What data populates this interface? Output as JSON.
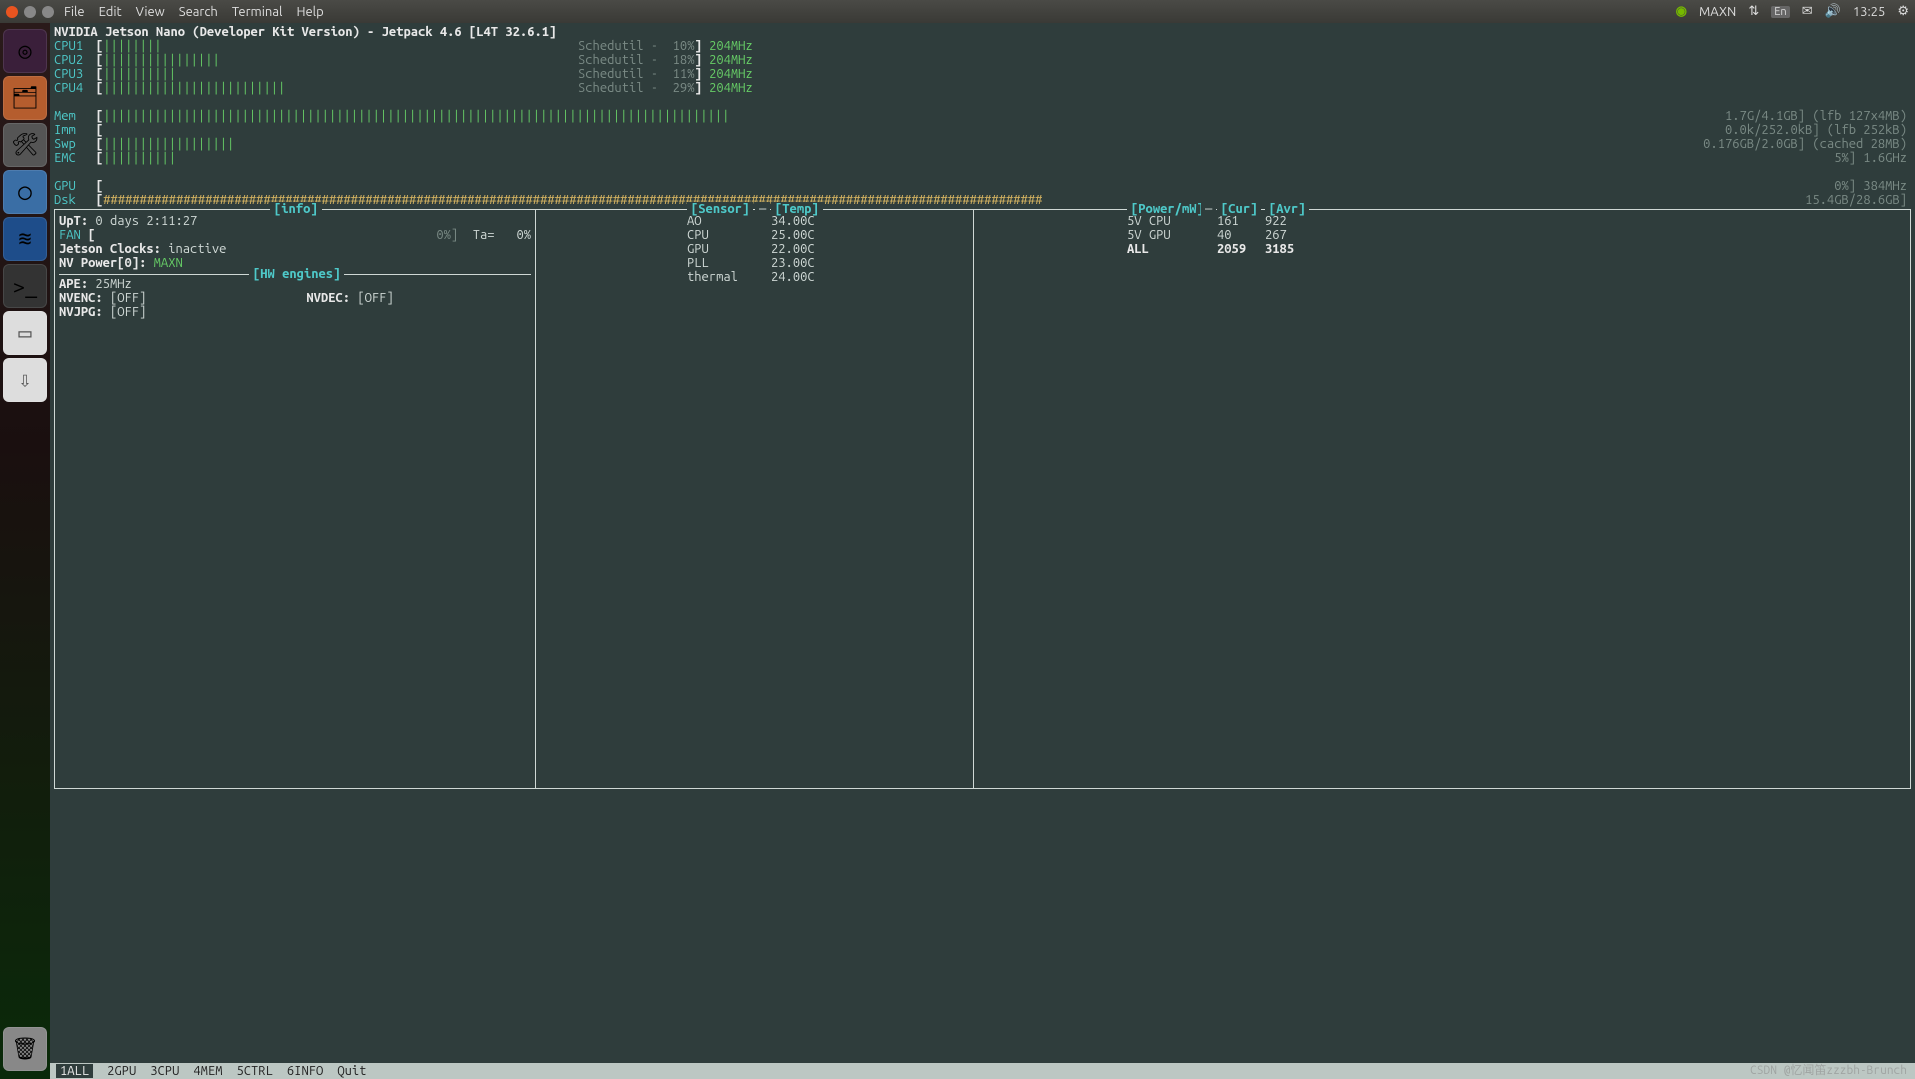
{
  "menubar": {
    "items": [
      "File",
      "Edit",
      "View",
      "Search",
      "Terminal",
      "Help"
    ],
    "status_label": "MAXN",
    "lang_label": "En",
    "time": "13:25"
  },
  "title": "NVIDIA Jetson Nano (Developer Kit Version) - Jetpack 4.6 [L4T 32.6.1]",
  "cpus": [
    {
      "label": "CPU1",
      "bar": "||||||||",
      "gov": "Schedutil",
      "pct": "10%",
      "freq": "204MHz"
    },
    {
      "label": "CPU2",
      "bar": "||||||||||||||||",
      "gov": "Schedutil",
      "pct": "18%",
      "freq": "204MHz"
    },
    {
      "label": "CPU3",
      "bar": "||||||||||",
      "gov": "Schedutil",
      "pct": "11%",
      "freq": "204MHz"
    },
    {
      "label": "CPU4",
      "bar": "|||||||||||||||||||||||||",
      "gov": "Schedutil",
      "pct": "29%",
      "freq": "204MHz"
    }
  ],
  "mem": {
    "label": "Mem",
    "bar": "||||||||||||||||||||||||||||||||||||||||||||||||||||||||||||||||||||||||||||||||||||||",
    "right": "1.7G/4.1GB] (lfb 127x4MB)"
  },
  "imm": {
    "label": "Imm",
    "bar": "",
    "right": "0.0k/252.0kB] (lfb 252kB)"
  },
  "swp": {
    "label": "Swp",
    "bar": "||||||||||||||||||",
    "right": "0.176GB/2.0GB] (cached 28MB)"
  },
  "emc": {
    "label": "EMC",
    "bar": "||||||||||",
    "right": "5%] 1.6GHz"
  },
  "gpu": {
    "label": "GPU",
    "bar": "",
    "right": "0%] 384MHz"
  },
  "dsk": {
    "label": "Dsk",
    "bar": "#################################################################################################################################",
    "right": "15.4GB/28.6GB]"
  },
  "pane_labels": {
    "info": "[info]",
    "sensor": "[Sensor]",
    "temp": "[Temp]",
    "power": "[Power/mW]",
    "cur": "[Cur]",
    "avr": "[Avr]",
    "hw": "[HW engines]"
  },
  "info": {
    "uptime_label": "UpT:",
    "uptime": "0 days 2:11:27",
    "fan_label": "FAN",
    "fan_pct": "0%]",
    "ta_label": "Ta=",
    "ta_val": "0%",
    "jclock_label": "Jetson Clocks:",
    "jclock_val": "inactive",
    "nvpower_label": "NV Power[0]:",
    "nvpower_val": "MAXN",
    "ape_label": "APE:",
    "ape_val": "25MHz",
    "nvenc_label": "NVENC:",
    "nvenc_val": "[OFF]",
    "nvdec_label": "NVDEC:",
    "nvdec_val": "[OFF]",
    "nvjpg_label": "NVJPG:",
    "nvjpg_val": "[OFF]"
  },
  "sensors": [
    {
      "name": "AO",
      "temp": "34.00C"
    },
    {
      "name": "CPU",
      "temp": "25.00C"
    },
    {
      "name": "GPU",
      "temp": "22.00C"
    },
    {
      "name": "PLL",
      "temp": "23.00C"
    },
    {
      "name": "thermal",
      "temp": "24.00C"
    }
  ],
  "power": [
    {
      "name": "5V CPU",
      "cur": "161",
      "avr": "922"
    },
    {
      "name": "5V GPU",
      "cur": "40",
      "avr": "267"
    },
    {
      "name": "ALL",
      "cur": "2059",
      "avr": "3185"
    }
  ],
  "status": {
    "tabs": [
      "1ALL",
      "2GPU",
      "3CPU",
      "4MEM",
      "5CTRL",
      "6INFO",
      "Quit"
    ],
    "watermark": "CSDN @忆闻笛zzzbh-Brunch"
  }
}
